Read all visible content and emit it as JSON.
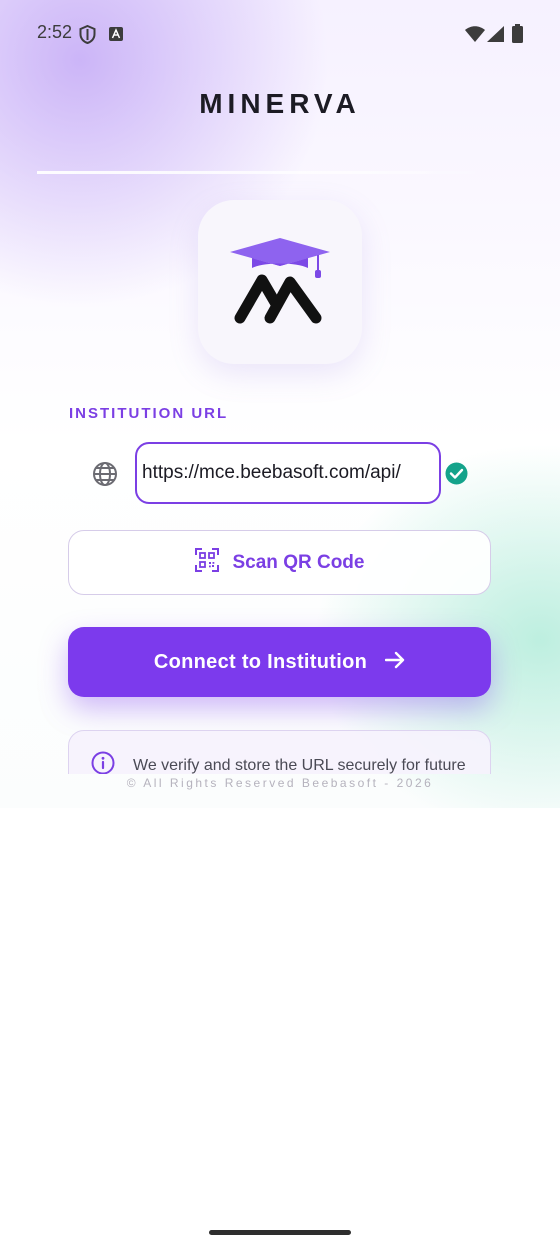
{
  "status_bar": {
    "time": "2:52",
    "icons": [
      "shield-icon",
      "font-icon",
      "wifi-icon",
      "signal-icon",
      "battery-icon"
    ]
  },
  "app": {
    "title": "MINERVA",
    "logo": "graduation-cap-logo",
    "accent_color": "#7c3aed",
    "success_color": "#14a38b"
  },
  "form": {
    "label": "INSTITUTION URL",
    "url_value": "https://mce.beebasoft.com/api/",
    "url_icon": "globe-icon",
    "valid_icon": "check-circle-icon",
    "scan_button_label": "Scan QR Code",
    "scan_icon": "qr-code-icon",
    "connect_button_label": "Connect to Institution",
    "connect_icon": "arrow-right-icon"
  },
  "info": {
    "text": "We verify and store the URL securely for future",
    "icon": "info-icon"
  },
  "footer": {
    "text": "© All Rights Reserved Beebasoft - 2026"
  }
}
